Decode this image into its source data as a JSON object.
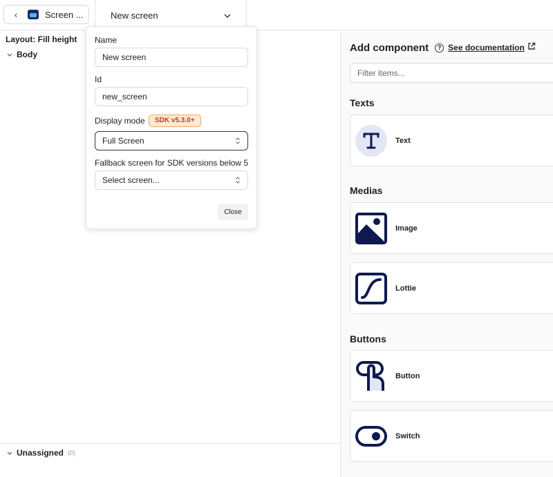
{
  "topbar": {
    "back_label": "Screen ...",
    "screen_select_label": "New screen"
  },
  "left": {
    "layout_label": "Layout: Fill height",
    "body_label": "Body",
    "unassigned_label": "Unassigned",
    "unassigned_count": "(0)"
  },
  "right": {
    "title": "Add component",
    "doc_link": "See documentation",
    "filter_placeholder": "Filter items...",
    "sections": {
      "texts": "Texts",
      "medias": "Medias",
      "buttons": "Buttons"
    },
    "components": {
      "text": "Text",
      "image": "Image",
      "lottie": "Lottie",
      "button": "Button",
      "switch": "Switch"
    },
    "icon_color": "#0e1a4f",
    "icon_bg": "#e3e6f5"
  },
  "popover": {
    "name_label": "Name",
    "name_value": "New screen",
    "id_label": "Id",
    "id_value": "new_screen",
    "display_mode_label": "Display mode",
    "sdk_badge": "SDK v5.3.0+",
    "display_mode_value": "Full Screen",
    "fallback_label": "Fallback screen for SDK versions below 5",
    "fallback_value": "Select screen...",
    "close_label": "Close"
  }
}
